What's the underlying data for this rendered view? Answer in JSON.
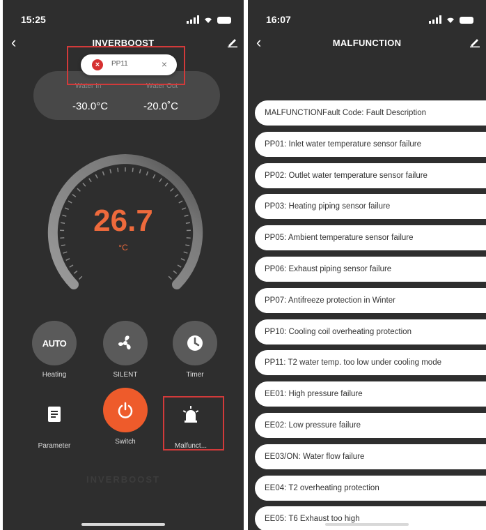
{
  "left": {
    "status_time": "15:25",
    "title": "INVERBOOST",
    "toast": {
      "code": "PP11"
    },
    "water_in_label": "Water In",
    "water_out_label": "Water Out",
    "water_in_value": "-30.0°C",
    "water_out_value": "-20.0˚C",
    "temperature": "26.7",
    "temperature_unit": "°C",
    "modes": [
      {
        "icon": "auto-text",
        "label": "Heating",
        "text": "AUTO"
      },
      {
        "icon": "fan-icon",
        "label": "SILENT"
      },
      {
        "icon": "clock-icon",
        "label": "Timer"
      }
    ],
    "actions": [
      {
        "icon": "document-icon",
        "label": "Parameter"
      },
      {
        "icon": "power-icon",
        "label": "Switch"
      },
      {
        "icon": "alarm-icon",
        "label": "Malfunct..."
      }
    ],
    "watermark": "INVERBOOST",
    "accent": "#ee6a3c"
  },
  "right": {
    "status_time": "16:07",
    "title": "MALFUNCTION",
    "faults": [
      "MALFUNCTIONFault Code: Fault Description",
      "PP01: Inlet water temperature sensor failure",
      "PP02: Outlet water temperature sensor failure",
      "PP03: Heating piping sensor failure",
      "PP05: Ambient temperature sensor failure",
      "PP06: Exhaust piping sensor failure",
      "PP07: Antifreeze protection in Winter",
      "PP10: Cooling coil overheating protection",
      "PP11: T2 water temp. too low under cooling mode",
      "EE01: High pressure failure",
      "EE02: Low pressure failure",
      "EE03/ON: Water flow failure",
      "EE04: T2 overheating protection",
      "EE05: T6 Exhaust too high"
    ]
  }
}
